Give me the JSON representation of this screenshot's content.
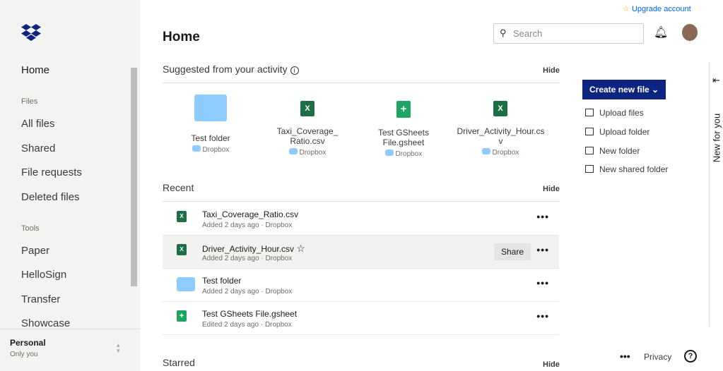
{
  "sidebar": {
    "home": "Home",
    "files_heading": "Files",
    "items": [
      "All files",
      "Shared",
      "File requests",
      "Deleted files"
    ],
    "tools_heading": "Tools",
    "tools": [
      "Paper",
      "HelloSign",
      "Transfer",
      "Showcase"
    ],
    "account": {
      "name": "Personal",
      "sub": "Only you"
    }
  },
  "header": {
    "title": "Home",
    "search_placeholder": "Search",
    "upgrade": "Upgrade account"
  },
  "suggested": {
    "heading": "Suggested from your activity",
    "hide": "Hide",
    "items": [
      {
        "name": "Test folder",
        "loc": "Dropbox",
        "type": "folder"
      },
      {
        "name": "Taxi_Coverage_Ratio.csv",
        "loc": "Dropbox",
        "type": "xls"
      },
      {
        "name": "Test GSheets File.gsheet",
        "loc": "Dropbox",
        "type": "gsheet"
      },
      {
        "name": "Driver_Activity_Hour.csv",
        "loc": "Dropbox",
        "type": "xls"
      }
    ]
  },
  "recent": {
    "heading": "Recent",
    "hide": "Hide",
    "share": "Share",
    "rows": [
      {
        "name": "Taxi_Coverage_Ratio.csv",
        "meta": "Added 2 days ago · Dropbox"
      },
      {
        "name": "Driver_Activity_Hour.csv",
        "meta": "Added 2 days ago · Dropbox"
      },
      {
        "name": "Test folder",
        "meta": "Added 2 days ago · Dropbox"
      },
      {
        "name": "Test GSheets File.gsheet",
        "meta": "Edited 2 days ago · Dropbox"
      }
    ]
  },
  "starred": {
    "heading": "Starred",
    "hide": "Hide"
  },
  "actions": {
    "create": "Create new file",
    "items": [
      "Upload files",
      "Upload folder",
      "New folder",
      "New shared folder"
    ]
  },
  "panel": {
    "label": "New for you"
  },
  "footer": {
    "privacy": "Privacy",
    "help": "?"
  },
  "colors": {
    "brand": "#0d2481"
  }
}
